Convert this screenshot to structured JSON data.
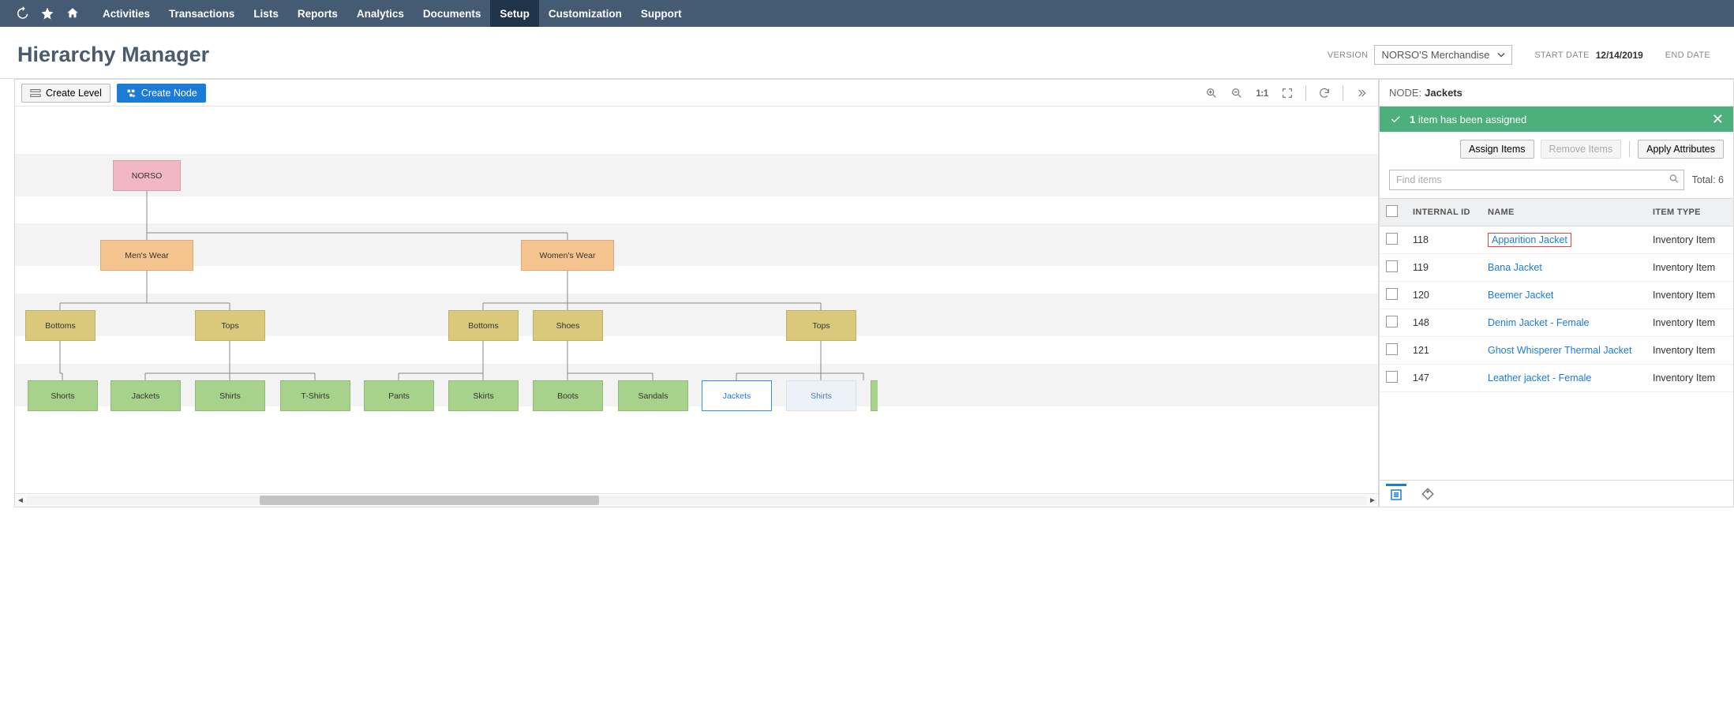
{
  "nav": {
    "items": [
      "Activities",
      "Transactions",
      "Lists",
      "Reports",
      "Analytics",
      "Documents",
      "Setup",
      "Customization",
      "Support"
    ],
    "active_index": 6
  },
  "page": {
    "title": "Hierarchy Manager",
    "version_label": "VERSION",
    "version_value": "NORSO'S Merchandise",
    "start_date_label": "START DATE",
    "start_date_value": "12/14/2019",
    "end_date_label": "END DATE",
    "end_date_value": ""
  },
  "toolbar": {
    "create_level": "Create Level",
    "create_node": "Create Node",
    "zoom_reset_text": "1:1"
  },
  "hierarchy": {
    "root": "NORSO",
    "cats": [
      "Men's Wear",
      "Women's Wear"
    ],
    "subs": [
      "Bottoms",
      "Tops",
      "Bottoms",
      "Shoes",
      "Tops"
    ],
    "leaves": [
      "Shorts",
      "Jackets",
      "Shirts",
      "T-Shirts",
      "Pants",
      "Skirts",
      "Boots",
      "Sandals",
      "Jackets",
      "Shirts"
    ],
    "selected_leaf_index": 8
  },
  "side": {
    "node_label": "NODE:",
    "node_name": "Jackets",
    "banner_count": "1",
    "banner_text": "item has been assigned",
    "assign_items": "Assign Items",
    "remove_items": "Remove Items",
    "apply_attributes": "Apply Attributes",
    "search_placeholder": "Find items",
    "total_prefix": "Total:",
    "total_count": "6",
    "columns": {
      "internal_id": "INTERNAL ID",
      "name": "NAME",
      "item_type": "ITEM TYPE"
    },
    "rows": [
      {
        "id": "118",
        "name": "Apparition Jacket",
        "type": "Inventory Item",
        "highlight": true
      },
      {
        "id": "119",
        "name": "Bana Jacket",
        "type": "Inventory Item"
      },
      {
        "id": "120",
        "name": "Beemer Jacket",
        "type": "Inventory Item"
      },
      {
        "id": "148",
        "name": "Denim Jacket - Female",
        "type": "Inventory Item"
      },
      {
        "id": "121",
        "name": "Ghost Whisperer Thermal Jacket",
        "type": "Inventory Item"
      },
      {
        "id": "147",
        "name": "Leather jacket - Female",
        "type": "Inventory Item"
      }
    ]
  }
}
